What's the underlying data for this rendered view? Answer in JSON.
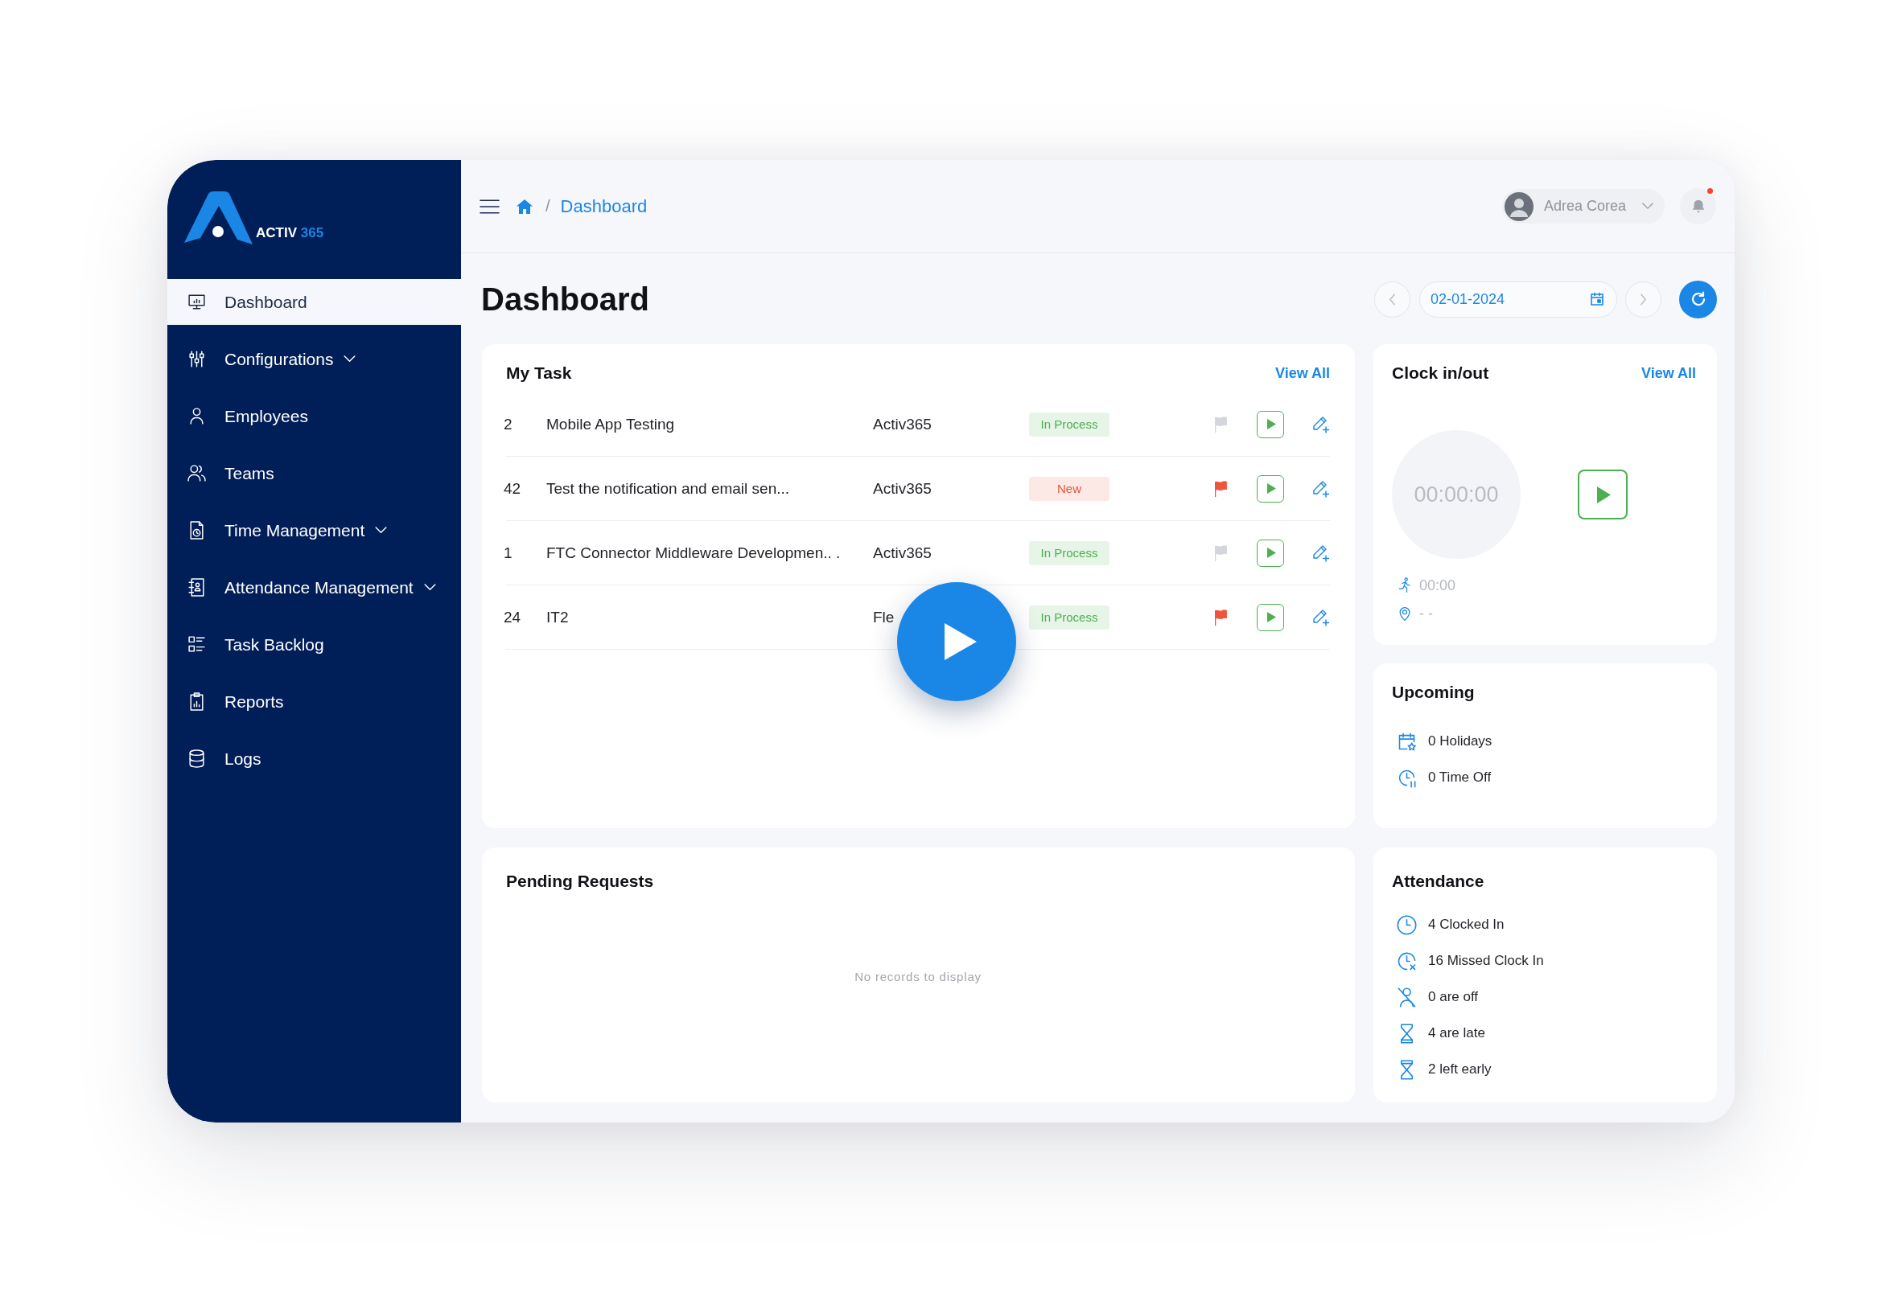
{
  "sidebar": {
    "logo": {
      "name": "ACTIV",
      "suffix": "365"
    },
    "items": [
      {
        "label": "Dashboard",
        "selected": true,
        "has_submenu": false
      },
      {
        "label": "Configurations",
        "selected": false,
        "has_submenu": true
      },
      {
        "label": "Employees",
        "selected": false,
        "has_submenu": false
      },
      {
        "label": "Teams",
        "selected": false,
        "has_submenu": false
      },
      {
        "label": "Time Management",
        "selected": false,
        "has_submenu": true
      },
      {
        "label": "Attendance Management",
        "selected": false,
        "has_submenu": true
      },
      {
        "label": "Task Backlog",
        "selected": false,
        "has_submenu": false
      },
      {
        "label": "Reports",
        "selected": false,
        "has_submenu": false
      },
      {
        "label": "Logs",
        "selected": false,
        "has_submenu": false
      }
    ]
  },
  "header": {
    "breadcrumb": {
      "separator": "/",
      "current": "Dashboard"
    },
    "user": {
      "name": "Adrea Corea"
    },
    "notifications": {
      "unread": true
    }
  },
  "page": {
    "title": "Dashboard",
    "date": "02-01-2024"
  },
  "my_task": {
    "title": "My Task",
    "link": "View All",
    "rows": [
      {
        "id": "2",
        "name": "Mobile App Testing",
        "project": "Activ365",
        "status": {
          "label": "In Process",
          "color": "#4caf50"
        },
        "flagged": false
      },
      {
        "id": "42",
        "name": "Test the notification and email sen...",
        "project": "Activ365",
        "status": {
          "label": "New",
          "color": "#e8553e"
        },
        "flagged": true
      },
      {
        "id": "1",
        "name": "FTC Connector Middleware Developmen.. .",
        "project": "Activ365",
        "status": {
          "label": "In Process",
          "color": "#4caf50"
        },
        "flagged": false
      },
      {
        "id": "24",
        "name": "IT2",
        "project": "Fle",
        "status": {
          "label": "In Process",
          "color": "#4caf50"
        },
        "flagged": true
      }
    ]
  },
  "clock": {
    "title": "Clock in/out",
    "link": "View All",
    "timer": "00:00:00",
    "elapsed": "00:00",
    "location": "- -"
  },
  "upcoming": {
    "title": "Upcoming",
    "items": [
      "0 Holidays",
      "0 Time Off"
    ]
  },
  "pending_requests": {
    "title": "Pending Requests",
    "empty_message": "No records to display"
  },
  "attendance": {
    "title": "Attendance",
    "items": [
      "4 Clocked In",
      "16 Missed Clock In",
      "0 are off",
      "4 are late",
      "2 left early"
    ]
  }
}
